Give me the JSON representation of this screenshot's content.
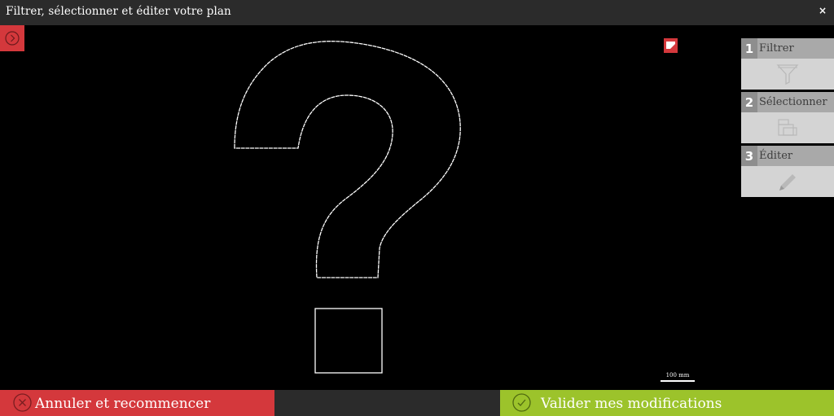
{
  "window": {
    "title": "Filtrer, sélectionner et éditer votre plan",
    "close_label": "×"
  },
  "toolbar": {
    "collapse_icon": "chevron-right-circle-icon",
    "corner_icon": "display-toggle-icon"
  },
  "steps": [
    {
      "number": "1",
      "label": "Filtrer",
      "icon": "funnel-icon"
    },
    {
      "number": "2",
      "label": "Sélectionner",
      "icon": "select-layers-icon"
    },
    {
      "number": "3",
      "label": "Éditer",
      "icon": "pencil-icon"
    }
  ],
  "scale": {
    "label": "100 mm"
  },
  "actions": {
    "cancel_label": "Annuler et recommencer",
    "cancel_icon": "x-circle-icon",
    "confirm_label": "Valider mes modifications",
    "confirm_icon": "check-circle-icon"
  },
  "colors": {
    "accent_red": "#d4383c",
    "accent_green": "#9cc32b",
    "bar_dark": "#2b2b2b",
    "canvas": "#000000"
  }
}
